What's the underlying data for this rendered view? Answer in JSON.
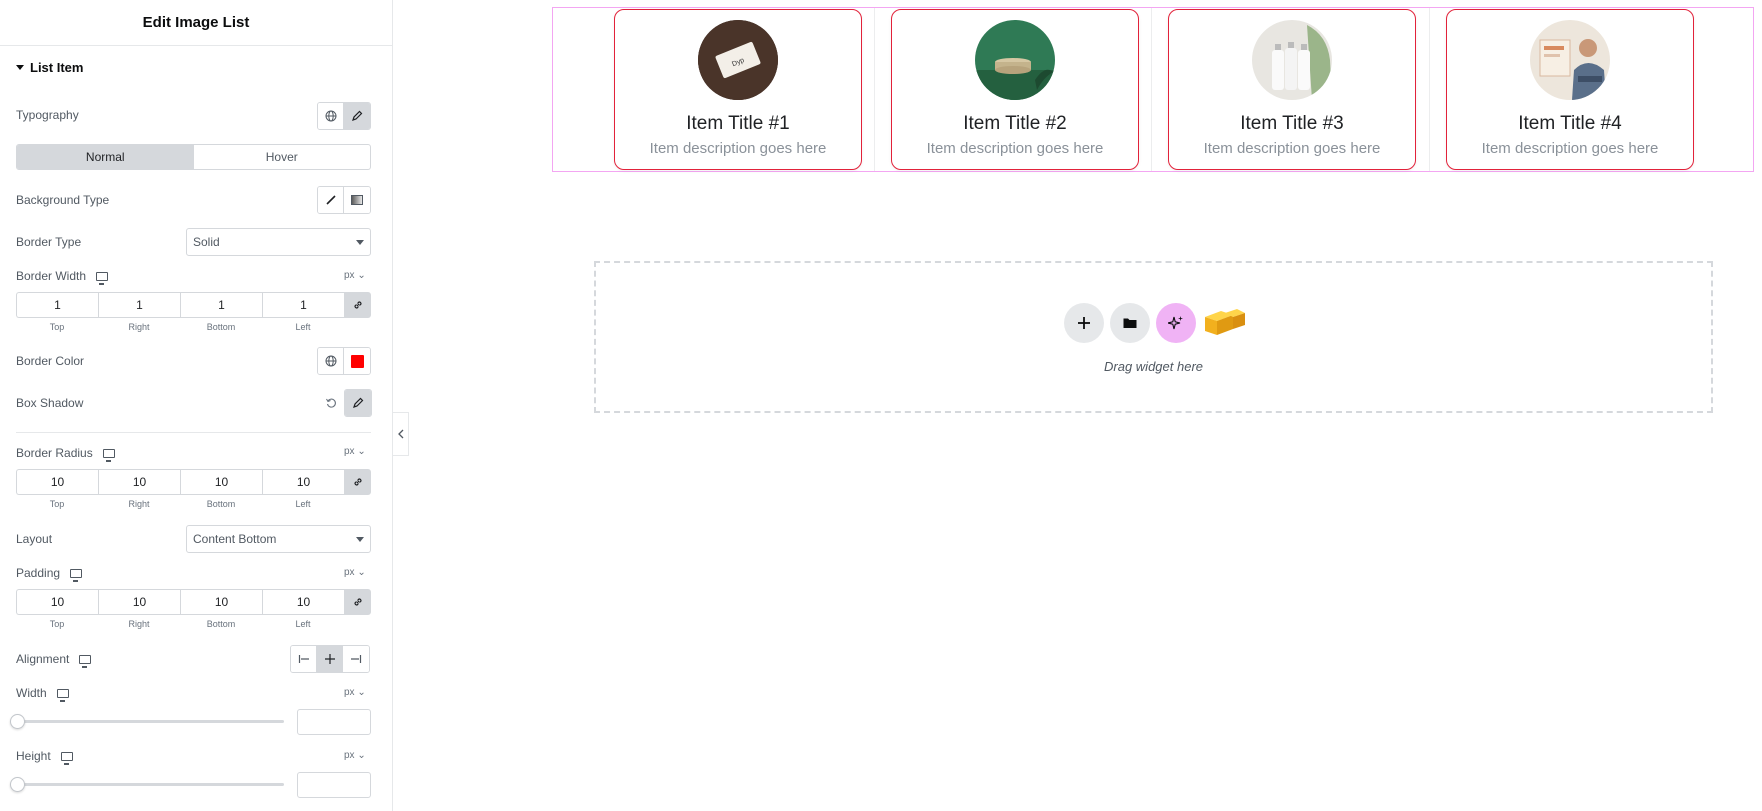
{
  "panel": {
    "title": "Edit Image List",
    "section": "List Item",
    "typography_label": "Typography",
    "tabs": [
      "Normal",
      "Hover"
    ],
    "background_type_label": "Background Type",
    "border_type_label": "Border Type",
    "border_type_value": "Solid",
    "border_width_label": "Border Width",
    "unit": "px ⌄",
    "border_width": [
      "1",
      "1",
      "1",
      "1"
    ],
    "side_labels": [
      "Top",
      "Right",
      "Bottom",
      "Left"
    ],
    "border_color_label": "Border Color",
    "border_color_value": "#ff0000",
    "box_shadow_label": "Box Shadow",
    "border_radius_label": "Border Radius",
    "border_radius": [
      "10",
      "10",
      "10",
      "10"
    ],
    "layout_label": "Layout",
    "layout_value": "Content Bottom",
    "padding_label": "Padding",
    "padding": [
      "10",
      "10",
      "10",
      "10"
    ],
    "alignment_label": "Alignment",
    "width_label": "Width",
    "height_label": "Height"
  },
  "cards": [
    {
      "title": "Item Title #1",
      "desc": "Item description goes here"
    },
    {
      "title": "Item Title #2",
      "desc": "Item description goes here"
    },
    {
      "title": "Item Title #3",
      "desc": "Item description goes here"
    },
    {
      "title": "Item Title #4",
      "desc": "Item description goes here"
    }
  ],
  "dropzone": {
    "text": "Drag widget here"
  },
  "colors": {
    "card_border": "#e2223a",
    "widget_outline": "#f3a6f2",
    "ai_button": "#f0b3f5"
  }
}
